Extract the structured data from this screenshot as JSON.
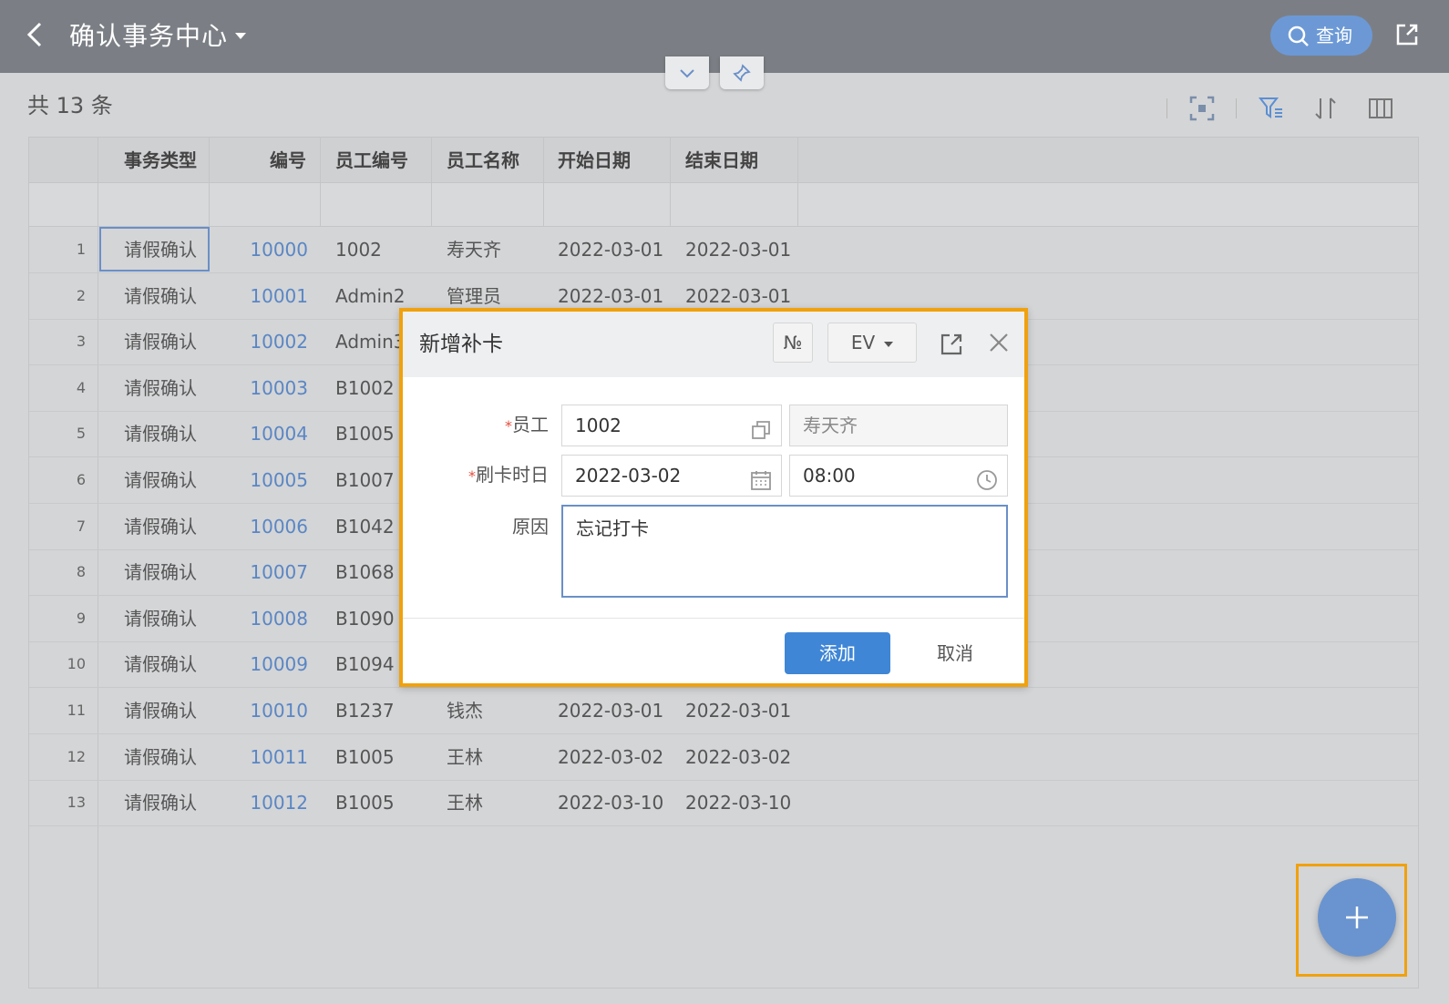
{
  "header": {
    "title": "确认事务中心",
    "search_label": "查询"
  },
  "toolbar": {
    "count_text": "共 13 条"
  },
  "table": {
    "columns": [
      "事务类型",
      "编号",
      "员工编号",
      "员工名称",
      "开始日期",
      "结束日期"
    ],
    "rows": [
      {
        "idx": "1",
        "type": "请假确认",
        "num": "10000",
        "empid": "1002",
        "name": "寿天齐",
        "start": "2022-03-01",
        "end": "2022-03-01"
      },
      {
        "idx": "2",
        "type": "请假确认",
        "num": "10001",
        "empid": "Admin2",
        "name": "管理员",
        "start": "2022-03-01",
        "end": "2022-03-01"
      },
      {
        "idx": "3",
        "type": "请假确认",
        "num": "10002",
        "empid": "Admin3",
        "name": "",
        "start": "",
        "end": ""
      },
      {
        "idx": "4",
        "type": "请假确认",
        "num": "10003",
        "empid": "B1002",
        "name": "",
        "start": "",
        "end": ""
      },
      {
        "idx": "5",
        "type": "请假确认",
        "num": "10004",
        "empid": "B1005",
        "name": "",
        "start": "",
        "end": ""
      },
      {
        "idx": "6",
        "type": "请假确认",
        "num": "10005",
        "empid": "B1007",
        "name": "",
        "start": "",
        "end": ""
      },
      {
        "idx": "7",
        "type": "请假确认",
        "num": "10006",
        "empid": "B1042",
        "name": "",
        "start": "",
        "end": ""
      },
      {
        "idx": "8",
        "type": "请假确认",
        "num": "10007",
        "empid": "B1068",
        "name": "",
        "start": "",
        "end": ""
      },
      {
        "idx": "9",
        "type": "请假确认",
        "num": "10008",
        "empid": "B1090",
        "name": "",
        "start": "",
        "end": ""
      },
      {
        "idx": "10",
        "type": "请假确认",
        "num": "10009",
        "empid": "B1094",
        "name": "",
        "start": "",
        "end": ""
      },
      {
        "idx": "11",
        "type": "请假确认",
        "num": "10010",
        "empid": "B1237",
        "name": "钱杰",
        "start": "2022-03-01",
        "end": "2022-03-01"
      },
      {
        "idx": "12",
        "type": "请假确认",
        "num": "10011",
        "empid": "B1005",
        "name": "王林",
        "start": "2022-03-02",
        "end": "2022-03-02"
      },
      {
        "idx": "13",
        "type": "请假确认",
        "num": "10012",
        "empid": "B1005",
        "name": "王林",
        "start": "2022-03-10",
        "end": "2022-03-10"
      }
    ]
  },
  "dialog": {
    "title": "新增补卡",
    "no_button": "№",
    "lang_button": "EV",
    "employee_label": "员工",
    "employee_id": "1002",
    "employee_name": "寿天齐",
    "date_label": "刷卡时日",
    "date_value": "2022-03-02",
    "time_value": "08:00",
    "reason_label": "原因",
    "reason_value": "忘记打卡",
    "add_label": "添加",
    "cancel_label": "取消",
    "required_mark": "*"
  },
  "fab": {
    "label": "+"
  },
  "colors": {
    "header_bg": "#7b7f85",
    "accent": "#3f86d6",
    "highlight": "#f0a10d",
    "link": "#5a86c4"
  }
}
